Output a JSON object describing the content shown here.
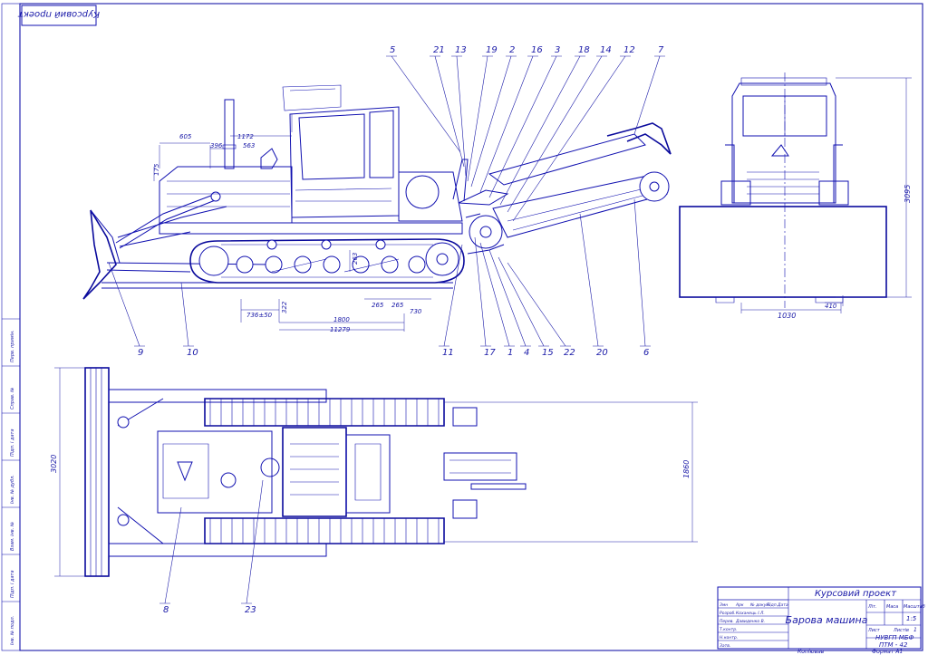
{
  "sheet": {
    "stamp": "Курсовий проект",
    "title": "Барова машина"
  },
  "side_view": {
    "dimensions": {
      "hood_length": "605",
      "gap": "396",
      "stack_to_cab": "1172",
      "stack_offset": "563",
      "hood_height": "175",
      "track_len_a": "736±50",
      "track_step": "322",
      "wheelbase": "1800",
      "overall": "11279",
      "roller_gap": "263",
      "roller_b": "265",
      "roller_c": "265",
      "rear": "730"
    },
    "callouts_top": [
      "5",
      "21",
      "13",
      "19",
      "2",
      "16",
      "3",
      "18",
      "14",
      "12",
      "7"
    ],
    "callouts_bottom": [
      "9",
      "10",
      "11",
      "17",
      "1",
      "4",
      "15",
      "22",
      "20",
      "6"
    ]
  },
  "front_view": {
    "height": "3095",
    "width": "1030",
    "offset": "410"
  },
  "plan_view": {
    "blade_width": "3020",
    "track_width": "1860",
    "callouts": [
      "8",
      "23"
    ]
  },
  "title_block": {
    "rows_left": [
      {
        "a": "Змн",
        "b": "Арк",
        "c": "№ докум.",
        "d": "Підп.",
        "e": "Дата"
      },
      {
        "a": "Розроб.",
        "b": "Коханець І.Л.",
        "c": "",
        "d": "",
        "e": ""
      },
      {
        "a": "Перев.",
        "b": "Давиденко В.",
        "c": "",
        "d": "",
        "e": ""
      },
      {
        "a": "Т.контр.",
        "b": "",
        "c": "",
        "d": "",
        "e": ""
      },
      {
        "a": "Н.контр.",
        "b": "",
        "c": "",
        "d": "",
        "e": ""
      },
      {
        "a": "Затв.",
        "b": "",
        "c": "",
        "d": "",
        "e": ""
      }
    ],
    "lit_label": "Літ.",
    "mass_label": "Маса",
    "scale_label": "Масштаб",
    "scale": "1:5",
    "sheet_label": "Лист",
    "sheets_label": "Листів",
    "sheets": "1",
    "org_line1": "НУВГП МБФ",
    "org_line2": "ПТМ - 42",
    "copied": "Копіював",
    "format": "Формат А1"
  },
  "side_strip": [
    "Інв. № подл.",
    "Підп. і дата",
    "Взам. інв. №",
    "Інв. № дубл.",
    "Підп. і дата",
    "Справ. №",
    "Перв. примін."
  ]
}
